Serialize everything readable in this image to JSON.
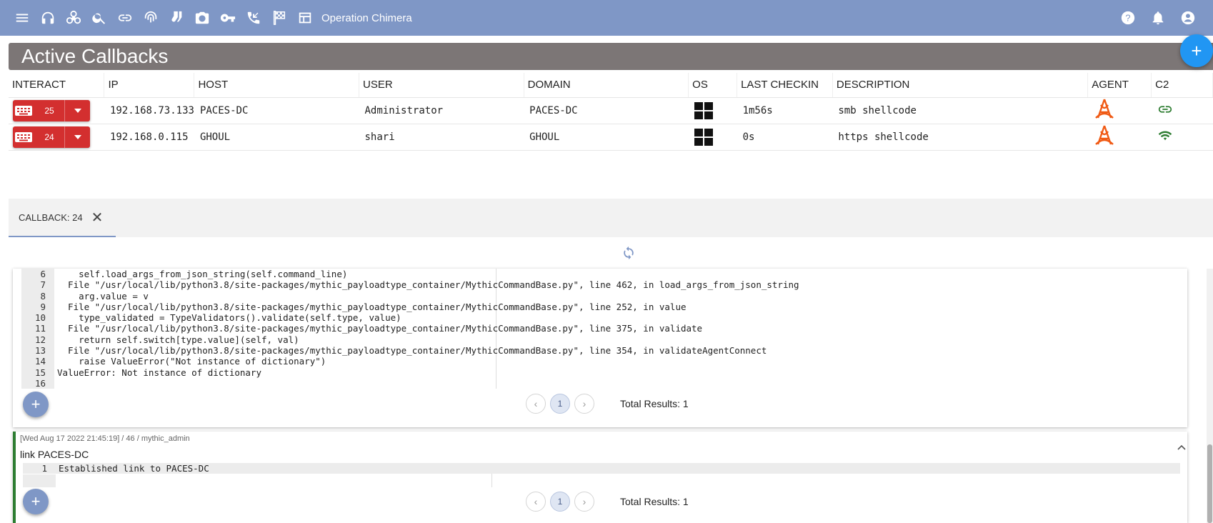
{
  "topbar": {
    "operation_name": "Operation Chimera",
    "icons": [
      "menu-icon",
      "headphones-icon",
      "biohazard-icon",
      "search-icon",
      "attachment-icon",
      "fingerprint-icon",
      "socks-icon",
      "camera-icon",
      "key-icon",
      "phone-callback-icon",
      "flag-checkered-icon",
      "table-layout-icon"
    ],
    "right_icons": [
      "help-icon",
      "notifications-icon",
      "account-icon"
    ]
  },
  "page_title": "Active Callbacks",
  "fab_label": "+",
  "table": {
    "headers": [
      "INTERACT",
      "IP",
      "HOST",
      "USER",
      "DOMAIN",
      "OS",
      "LAST CHECKIN",
      "DESCRIPTION",
      "AGENT",
      "C2"
    ],
    "rows": [
      {
        "id": "25",
        "ip": "192.168.73.133",
        "host": "PACES-DC",
        "user": "Administrator",
        "domain": "PACES-DC",
        "os": "windows",
        "last_checkin": "1m56s",
        "description": "smb shellcode",
        "agent": "apollo",
        "c2": "link"
      },
      {
        "id": "24",
        "ip": "192.168.0.115",
        "host": "GHOUL",
        "user": "shari",
        "domain": "GHOUL",
        "os": "windows",
        "last_checkin": "0s",
        "description": "https shellcode",
        "agent": "apollo",
        "c2": "wifi"
      }
    ]
  },
  "tab": {
    "label": "CALLBACK: 24",
    "close": "✕"
  },
  "output1": {
    "lines": [
      {
        "n": "6",
        "t": "    self.load_args_from_json_string(self.command_line)"
      },
      {
        "n": "7",
        "t": "  File \"/usr/local/lib/python3.8/site-packages/mythic_payloadtype_container/MythicCommandBase.py\", line 462, in load_args_from_json_string"
      },
      {
        "n": "8",
        "t": "    arg.value = v"
      },
      {
        "n": "9",
        "t": "  File \"/usr/local/lib/python3.8/site-packages/mythic_payloadtype_container/MythicCommandBase.py\", line 252, in value"
      },
      {
        "n": "10",
        "t": "    type_validated = TypeValidators().validate(self.type, value)"
      },
      {
        "n": "11",
        "t": "  File \"/usr/local/lib/python3.8/site-packages/mythic_payloadtype_container/MythicCommandBase.py\", line 375, in validate"
      },
      {
        "n": "12",
        "t": "    return self.switch[type.value](self, val)"
      },
      {
        "n": "13",
        "t": "  File \"/usr/local/lib/python3.8/site-packages/mythic_payloadtype_container/MythicCommandBase.py\", line 354, in validateAgentConnect"
      },
      {
        "n": "14",
        "t": "    raise ValueError(\"Not instance of dictionary\")"
      },
      {
        "n": "15",
        "t": "ValueError: Not instance of dictionary"
      },
      {
        "n": "16",
        "t": ""
      }
    ],
    "page": "1",
    "total": "Total Results: 1"
  },
  "task2": {
    "meta": "[Wed Aug 17 2022 21:45:19] / 46 / mythic_admin",
    "command": "link PACES-DC",
    "lines": [
      {
        "n": "1",
        "t": "Established link to PACES-DC"
      }
    ],
    "page": "1",
    "total": "Total Results: 1"
  },
  "colors": {
    "topbar": "#7f97c6",
    "banner": "#7c7676",
    "interact": "#d32f2f",
    "agent": "#f05a14",
    "c2": "#2e7d32",
    "fab": "#2196f3"
  }
}
